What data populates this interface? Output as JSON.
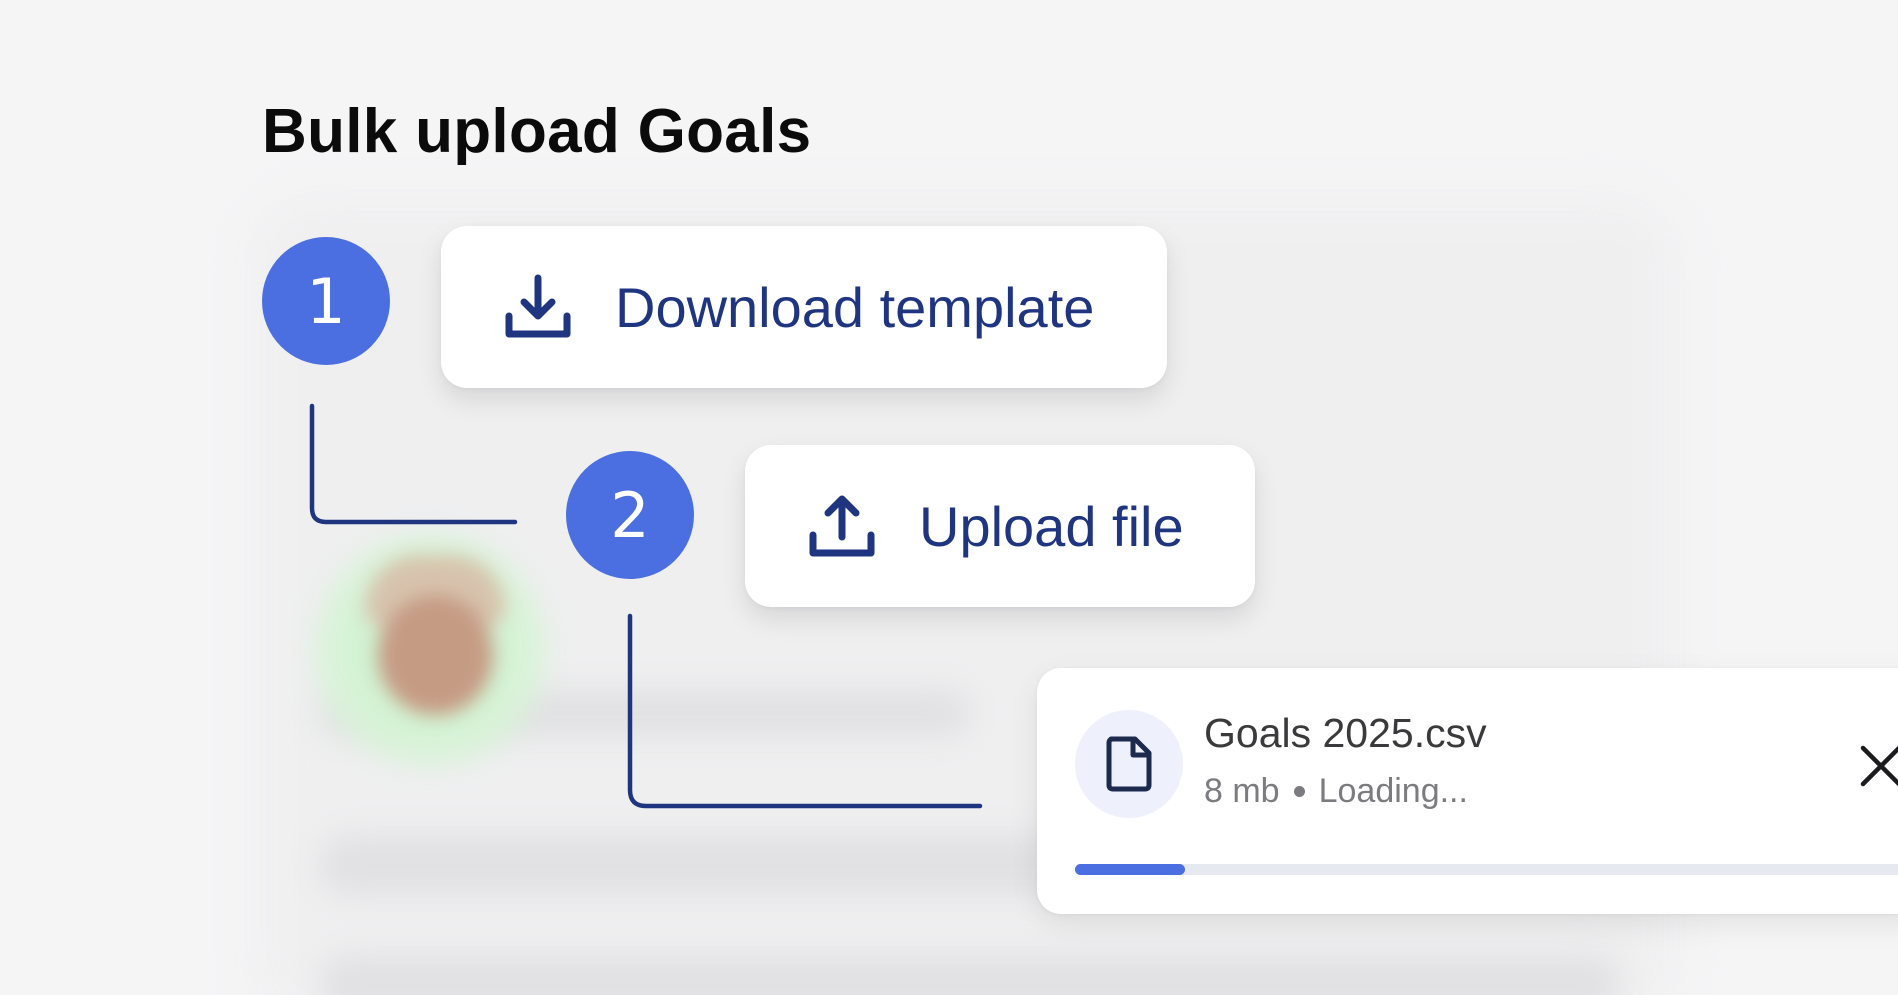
{
  "page": {
    "title": "Bulk upload Goals"
  },
  "steps": [
    {
      "number": "1",
      "label": "Download template",
      "icon": "download-icon"
    },
    {
      "number": "2",
      "label": "Upload file",
      "icon": "upload-icon"
    }
  ],
  "file": {
    "name": "Goals 2025.csv",
    "size": "8 mb",
    "status": "Loading...",
    "progress": 0.125,
    "icon": "file-icon",
    "close_icon": "close-icon"
  },
  "colors": {
    "accent": "#4b6fe0",
    "label": "#1f3580",
    "connector": "#1f3580",
    "background": "#f5f5f6"
  }
}
